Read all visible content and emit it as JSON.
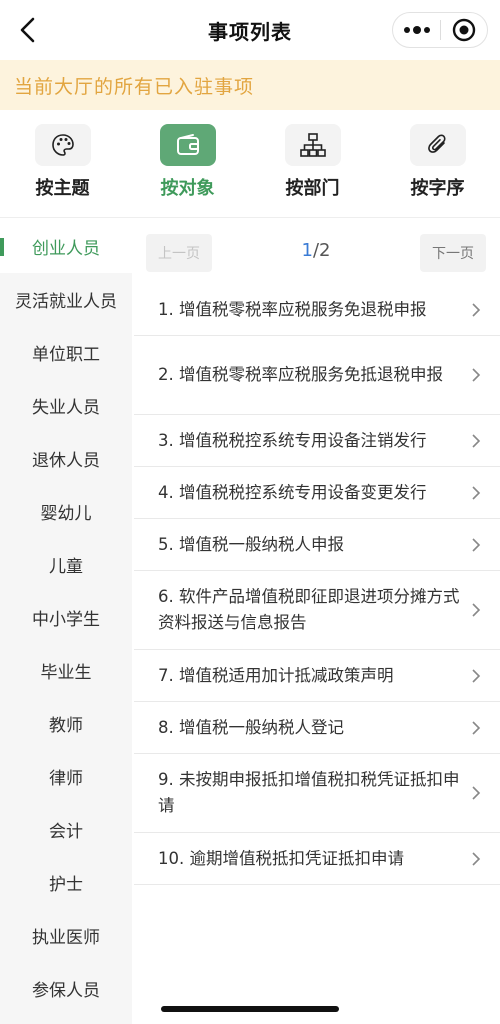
{
  "header": {
    "title": "事项列表",
    "back_icon": "chevron-left-icon",
    "more_icon": "more-dots-icon",
    "close_icon": "target-close-icon"
  },
  "banner": {
    "text": "当前大厅的所有已入驻事项"
  },
  "categories": [
    {
      "label": "按主题",
      "icon": "palette-icon",
      "active": false
    },
    {
      "label": "按对象",
      "icon": "wallet-icon",
      "active": true
    },
    {
      "label": "按部门",
      "icon": "org-chart-icon",
      "active": false
    },
    {
      "label": "按字序",
      "icon": "paperclip-icon",
      "active": false
    }
  ],
  "sidebar": {
    "items": [
      "创业人员",
      "灵活就业人员",
      "单位职工",
      "失业人员",
      "退休人员",
      "婴幼儿",
      "儿童",
      "中小学生",
      "毕业生",
      "教师",
      "律师",
      "会计",
      "护士",
      "执业医师",
      "参保人员"
    ],
    "active_index": 0
  },
  "pager": {
    "prev_label": "上一页",
    "next_label": "下一页",
    "current": "1",
    "separator": "/",
    "total": "2"
  },
  "list": {
    "items": [
      {
        "text": "1. 增值税零税率应税服务免退税申报"
      },
      {
        "text": "2. 增值税零税率应税服务免抵退税申报"
      },
      {
        "text": "3. 增值税税控系统专用设备注销发行"
      },
      {
        "text": "4. 增值税税控系统专用设备变更发行"
      },
      {
        "text": "5. 增值税一般纳税人申报"
      },
      {
        "text": "6. 软件产品增值税即征即退进项分摊方式资料报送与信息报告"
      },
      {
        "text": "7. 增值税适用加计抵减政策声明"
      },
      {
        "text": "8. 增值税一般纳税人登记"
      },
      {
        "text": "9. 未按期申报抵扣增值税扣税凭证抵扣申请"
      },
      {
        "text": "10. 逾期增值税抵扣凭证抵扣申请"
      }
    ]
  },
  "colors": {
    "accent_green": "#3f9a5b",
    "banner_bg": "#fdf3dd",
    "banner_text": "#e2a540",
    "page_current": "#3a7bd5"
  }
}
